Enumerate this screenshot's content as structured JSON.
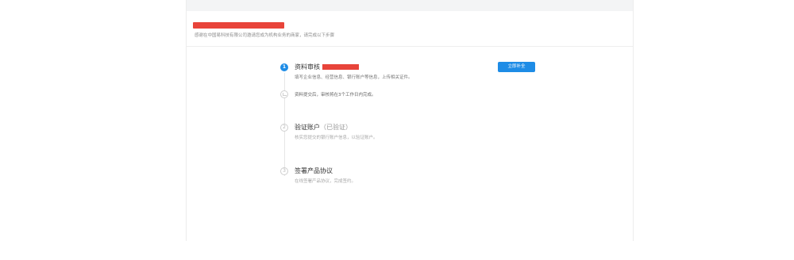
{
  "header": {
    "intro": "感谢在中国易科技有限公司邀请您成为机构业务的商家，请完成以下步骤"
  },
  "steps": [
    {
      "number": "1",
      "title": "资料审核",
      "desc": "填写企业信息、经营信息、银行账户等信息，上传相关证件。"
    },
    {
      "number": "",
      "desc": "资料提交后，审核将在3个工作日内完成。"
    },
    {
      "number": "2",
      "title": "验证账户",
      "title_suffix": "（已验证）",
      "desc": "核实您提交的银行账户信息，以验证账户。"
    },
    {
      "number": "3",
      "title": "签署产品协议",
      "desc": "在线签署产品协议，完成签约。"
    }
  ],
  "action": {
    "label": "立即补全"
  },
  "colors": {
    "accent": "#1e8ce6",
    "redaction": "#e8443a"
  }
}
